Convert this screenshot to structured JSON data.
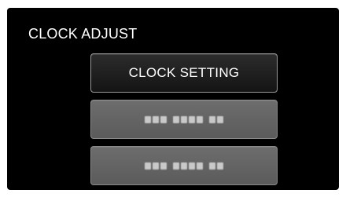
{
  "header": {
    "title": "CLOCK ADJUST"
  },
  "menu": {
    "items": [
      {
        "label": "CLOCK SETTING",
        "state": "selected"
      },
      {
        "label": "",
        "state": "disabled"
      },
      {
        "label": "",
        "state": "disabled"
      }
    ]
  },
  "colors": {
    "screen_bg": "#000000",
    "selected_button_bg": "#1f1f1f",
    "disabled_button_bg": "#666666",
    "text": "#ffffff"
  }
}
